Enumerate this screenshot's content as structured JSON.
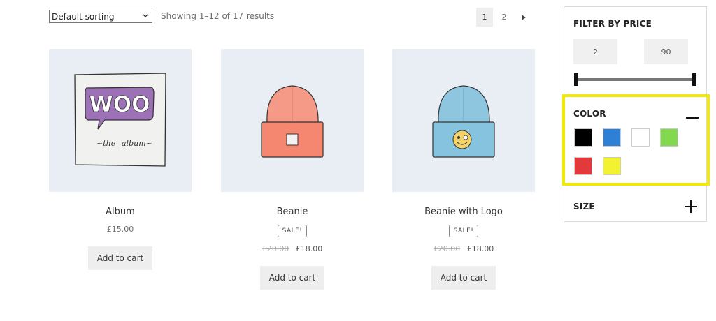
{
  "toolbar": {
    "sort_value": "Default sorting",
    "result_count": "Showing 1–12 of 17 results"
  },
  "pagination": {
    "pages": [
      "1",
      "2"
    ],
    "current_page": "1",
    "next_icon": "triangle-right-icon"
  },
  "products": [
    {
      "title": "Album",
      "price": "£15.00",
      "add_label": "Add to cart"
    },
    {
      "title": "Beanie",
      "sale": "SALE!",
      "old_price": "£20.00",
      "new_price": "£18.00",
      "add_label": "Add to cart"
    },
    {
      "title": "Beanie with Logo",
      "sale": "SALE!",
      "old_price": "£20.00",
      "new_price": "£18.00",
      "add_label": "Add to cart"
    }
  ],
  "sidebar": {
    "price_filter": {
      "title": "FILTER BY PRICE",
      "min": "2",
      "max": "90"
    },
    "color_filter": {
      "title": "COLOR",
      "swatches": [
        "#000000",
        "#2e7fd6",
        "#ffffff",
        "#82d94f",
        "#e23a3a",
        "#f2f233"
      ],
      "highlight_color": "#f2ea00"
    },
    "size_filter": {
      "title": "SIZE"
    }
  }
}
